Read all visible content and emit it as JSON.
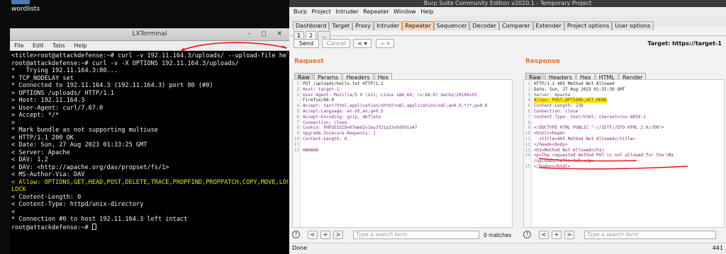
{
  "desktop": {
    "icon_label": "wordlists"
  },
  "terminal": {
    "title": "LXTerminal",
    "window_buttons": "– ◻ ✕",
    "menu": [
      "File",
      "Edit",
      "Tabs",
      "Help"
    ],
    "lines": [
      {
        "text": "<title>root@attackdefense:~# curl -v 192.11.164.3/uploads/ --upload-file hello",
        "hl": false
      },
      {
        "text": "root@attackdefense:~# curl -v -X OPTIONS 192.11.164.3/uploads/",
        "hl": false
      },
      {
        "text": "*   Trying 192.11.164.3:80...",
        "hl": false
      },
      {
        "text": "* TCP_NODELAY set",
        "hl": false
      },
      {
        "text": "* Connected to 192.11.164.3 (192.11.164.3) port 80 (#0)",
        "hl": false
      },
      {
        "text": "> OPTIONS /uploads/ HTTP/1.1",
        "hl": false
      },
      {
        "text": "> Host: 192.11.164.3",
        "hl": false
      },
      {
        "text": "> User-Agent: curl/7.67.0",
        "hl": false
      },
      {
        "text": "> Accept: */*",
        "hl": false
      },
      {
        "text": ">",
        "hl": false
      },
      {
        "text": "* Mark bundle as not supporting multiuse",
        "hl": false
      },
      {
        "text": "< HTTP/1.1 200 OK",
        "hl": false
      },
      {
        "text": "< Date: Sun, 27 Aug 2023 01:33:25 GMT",
        "hl": false
      },
      {
        "text": "< Server: Apache",
        "hl": false
      },
      {
        "text": "< DAV: 1,2",
        "hl": false
      },
      {
        "text": "< DAV: <http://apache.org/dav/propset/fs/1>",
        "hl": false
      },
      {
        "text": "< MS-Author-Via: DAV",
        "hl": false
      },
      {
        "text": "< Allow: OPTIONS,GET,HEAD,POST,DELETE,TRACE,PROPFIND,PROPPATCH,COPY,MOVE,LOCK,",
        "hl": true
      },
      {
        "text": "LOCK",
        "hl": true
      },
      {
        "text": "< Content-Length: 0",
        "hl": false
      },
      {
        "text": "< Content-Type: httpd/unix-directory",
        "hl": false
      },
      {
        "text": "<",
        "hl": false
      },
      {
        "text": "* Connection #0 to host 192.11.164.3 left intact",
        "hl": false
      },
      {
        "text": "root@attackdefense:~# ",
        "hl": false
      }
    ]
  },
  "burp": {
    "title": "Burp Suite Community Edition v2020.1 - Temporary Project",
    "menu": [
      "Burp",
      "Project",
      "Intruder",
      "Repeater",
      "Window",
      "Help"
    ],
    "main_tabs": [
      "Dashboard",
      "Target",
      "Proxy",
      "Intruder",
      "Repeater",
      "Sequencer",
      "Decoder",
      "Comparer",
      "Extender",
      "Project options",
      "User options"
    ],
    "active_tab": "Repeater",
    "repeater_tabs": [
      "1",
      "2",
      "..."
    ],
    "active_repeater_tab": "2",
    "send_label": "Send",
    "cancel_label": "Cancel",
    "back_label": "< ▾",
    "forward_label": "> ▾",
    "target_label": "Target: https://target-1",
    "request": {
      "heading": "Request",
      "subtabs": [
        "Raw",
        "Params",
        "Headers",
        "Hex"
      ],
      "lines": [
        {
          "n": "1",
          "t": "PUT /uploads/hello.txt HTTP/1.1",
          "c": "plain"
        },
        {
          "n": "2",
          "t": "Host: target-1",
          "c": "hname"
        },
        {
          "n": "3",
          "t": "User-Agent: Mozilla/5.0 (X11; Linux x86_64; rv:68.0) Gecko/20100101",
          "c": "hname"
        },
        {
          "n": "",
          "t": "Firefox/68.0",
          "c": "plain"
        },
        {
          "n": "4",
          "t": "Accept: text/html,application/xhtml+xml,application/xml;q=0.9,*/*;q=0.8",
          "c": "hname"
        },
        {
          "n": "5",
          "t": "Accept-Language: en-US,en;q=0.5",
          "c": "hname"
        },
        {
          "n": "6",
          "t": "Accept-Encoding: gzip, deflate",
          "c": "hname"
        },
        {
          "n": "7",
          "t": "Connection: close",
          "c": "hname"
        },
        {
          "n": "8",
          "t": "Cookie: PHPSESSID=07mmd2v3au3f2ip23vhdh9io47",
          "c": "hname"
        },
        {
          "n": "9",
          "t": "Upgrade-Insecure-Requests: 1",
          "c": "hname"
        },
        {
          "n": "10",
          "t": "Content-Length: 6",
          "c": "hname"
        },
        {
          "n": "11",
          "t": "",
          "c": "plain"
        },
        {
          "n": "12",
          "t": "HAHAHA",
          "c": "body"
        }
      ],
      "search_placeholder": "Type a search term",
      "matches": "0 matches"
    },
    "response": {
      "heading": "Response",
      "subtabs": [
        "Raw",
        "Headers",
        "Hex",
        "HTML",
        "Render"
      ],
      "lines": [
        {
          "n": "1",
          "t": "HTTP/1.1 405 Method Not Allowed",
          "c": "plain"
        },
        {
          "n": "2",
          "t": "Date: Sun, 27 Aug 2023 01:32:39 GMT",
          "c": "plain"
        },
        {
          "n": "3",
          "t": "Server: Apache",
          "c": "hname"
        },
        {
          "n": "4",
          "t": "Allow: POST,OPTIONS,GET,HEAD",
          "c": "yellow"
        },
        {
          "n": "5",
          "t": "Content-Length: 238",
          "c": "hname"
        },
        {
          "n": "6",
          "t": "Connection: close",
          "c": "hname"
        },
        {
          "n": "7",
          "t": "Content-Type: text/html; charset=iso-8859-1",
          "c": "hname"
        },
        {
          "n": "8",
          "t": "",
          "c": "plain"
        },
        {
          "n": "9",
          "t": "<!DOCTYPE HTML PUBLIC \"-//IETF//DTD HTML 2.0//EN\">",
          "c": "body"
        },
        {
          "n": "10",
          "t": "<html><head>",
          "c": "body"
        },
        {
          "n": "11",
          "t": "  <title>405 Method Not Allowed</title>",
          "c": "body"
        },
        {
          "n": "12",
          "t": "</head><body>",
          "c": "body"
        },
        {
          "n": "13",
          "t": "<h1>Method Not Allowed</h1>",
          "c": "body"
        },
        {
          "n": "14",
          "t": "<p>The requested method PUT is not allowed for the URL",
          "c": "body"
        },
        {
          "n": "",
          "t": "/uploads/hello.txt.</p>",
          "c": "body"
        },
        {
          "n": "15",
          "t": "</body></html>",
          "c": "body"
        }
      ],
      "search_placeholder": "Type a search term",
      "matches": "0 matches"
    },
    "search_help": "?",
    "search_prev": "<",
    "search_add": "+",
    "search_next": ">",
    "status": "Done",
    "bytes": "441"
  }
}
